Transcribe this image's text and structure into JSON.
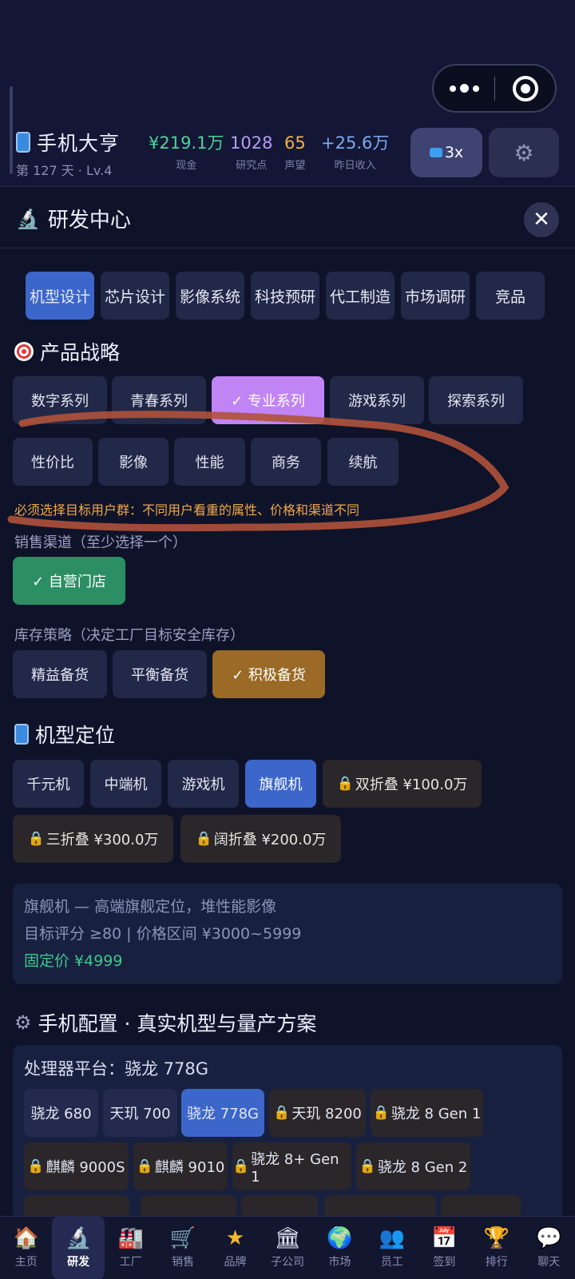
{
  "header": {
    "game_name": "手机大亨",
    "day_level": "第 127 天 · Lv.4",
    "stats": [
      {
        "value": "¥219.1万",
        "label": "现金",
        "color": "#4fd39a"
      },
      {
        "value": "1028",
        "label": "研究点",
        "color": "#b89cf5"
      },
      {
        "value": "65",
        "label": "声望",
        "color": "#f2b23c"
      },
      {
        "value": "+25.6万",
        "label": "昨日收入",
        "color": "#7fa9f2"
      }
    ],
    "speed_label": "3x",
    "gear_glyph": "⚙"
  },
  "panel": {
    "title": "研发中心",
    "close_glyph": "✕"
  },
  "tabs": [
    "机型设计",
    "芯片设计",
    "影像系统",
    "科技预研",
    "代工制造",
    "市场调研",
    "竞品"
  ],
  "strategy": {
    "title": "产品战略",
    "series": [
      "数字系列",
      "青春系列",
      "✓ 专业系列",
      "游戏系列",
      "探索系列"
    ],
    "audiences": [
      "性价比",
      "影像",
      "性能",
      "商务",
      "续航"
    ],
    "warning": "必须选择目标用户群：不同用户看重的属性、价格和渠道不同",
    "channel_label": "销售渠道（至少选择一个）",
    "channel": "✓ 自营门店",
    "inventory_label": "库存策略（决定工厂目标安全库存）",
    "inventory": [
      "精益备货",
      "平衡备货",
      "✓ 积极备货"
    ]
  },
  "positioning": {
    "title": "机型定位",
    "tiers": [
      "千元机",
      "中端机",
      "游戏机",
      "旗舰机"
    ],
    "locked": [
      "双折叠 ¥100.0万",
      "三折叠 ¥300.0万",
      "阔折叠 ¥200.0万"
    ],
    "info_line1": "旗舰机 — 高端旗舰定位，堆性能影像",
    "info_line2": "目标评分 ≥80 | 价格区间 ¥3000~5999",
    "info_price": "固定价 ¥4999"
  },
  "config": {
    "title": "手机配置 · 真实机型与量产方案",
    "platform_label": "处理器平台：骁龙 778G",
    "chips_row1": [
      "骁龙 680",
      "天玑 700",
      "骁龙 778G",
      "天玑 8200",
      "骁龙 8 Gen 1"
    ],
    "chips_row2": [
      "麒麟 9000S",
      "麒麟 9010",
      "骁龙 8+ Gen 1",
      "骁龙 8 Gen 2"
    ]
  },
  "nav": [
    {
      "label": "主页",
      "icon": "🏠"
    },
    {
      "label": "研发",
      "icon": "🔬"
    },
    {
      "label": "工厂",
      "icon": "🏭"
    },
    {
      "label": "销售",
      "icon": "🛒"
    },
    {
      "label": "品牌",
      "icon": "★"
    },
    {
      "label": "子公司",
      "icon": "🏛"
    },
    {
      "label": "市场",
      "icon": "🌍"
    },
    {
      "label": "员工",
      "icon": "👥"
    },
    {
      "label": "签到",
      "icon": "📅"
    },
    {
      "label": "排行",
      "icon": "🏆"
    },
    {
      "label": "聊天",
      "icon": "💬"
    }
  ]
}
